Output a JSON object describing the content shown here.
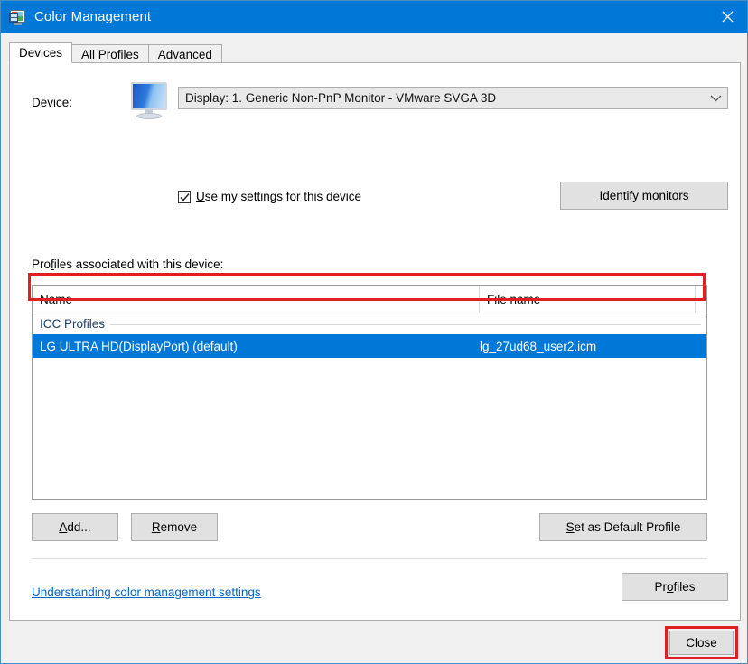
{
  "window": {
    "title": "Color Management",
    "icon": "color-management-icon",
    "close_icon": "close-icon"
  },
  "tabs": [
    {
      "label": "Devices",
      "active": true
    },
    {
      "label": "All Profiles",
      "active": false
    },
    {
      "label": "Advanced",
      "active": false
    }
  ],
  "device_section": {
    "label": "Device:",
    "label_accel": "D",
    "icon": "monitor-icon",
    "combo_value": "Display: 1. Generic Non-PnP Monitor - VMware SVGA 3D",
    "combo_arrow_icon": "chevron-down-icon",
    "checkbox": {
      "label": "Use my settings for this device",
      "accel": "U",
      "checked": true,
      "check_icon": "checkmark-icon"
    },
    "identify_button": "Identify monitors",
    "identify_accel": "I"
  },
  "profiles_section": {
    "label": "Profiles associated with this device:",
    "label_accel": "f",
    "columns": [
      "Name",
      "File name"
    ],
    "group_header": "ICC Profiles",
    "rows": [
      {
        "name": "LG ULTRA HD(DisplayPort) (default)",
        "file_name": "lg_27ud68_user2.icm",
        "selected": true,
        "highlighted": true
      }
    ]
  },
  "buttons": {
    "add": "Add...",
    "add_accel": "A",
    "remove": "Remove",
    "remove_accel": "R",
    "set_default": "Set as Default Profile",
    "set_default_accel": "S",
    "profiles": "Profiles",
    "profiles_accel": "o",
    "close": "Close"
  },
  "link": {
    "text": "Understanding color management settings"
  },
  "colors": {
    "title_bar": "#0078d7",
    "selection": "#0078d7",
    "annotation": "#e02020",
    "link": "#0066cc",
    "window_border": "#4a8fc4",
    "button_face": "#e1e1e1",
    "panel": "#ffffff"
  },
  "annotations": [
    {
      "target": "selected-profile-row",
      "color": "#e02020"
    },
    {
      "target": "close-button",
      "color": "#e02020"
    }
  ]
}
